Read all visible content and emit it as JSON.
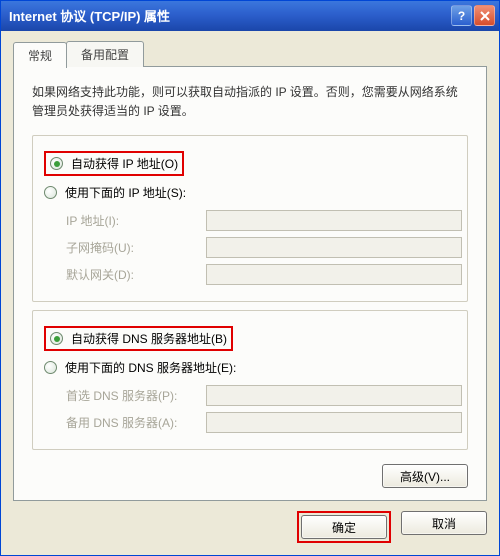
{
  "window": {
    "title": "Internet 协议 (TCP/IP) 属性"
  },
  "tabs": {
    "general": "常规",
    "alternate": "备用配置"
  },
  "description": "如果网络支持此功能，则可以获取自动指派的 IP 设置。否则，您需要从网络系统管理员处获得适当的 IP 设置。",
  "ip": {
    "auto": "自动获得 IP 地址(O)",
    "manual": "使用下面的 IP 地址(S):",
    "addr_label": "IP 地址(I):",
    "mask_label": "子网掩码(U):",
    "gateway_label": "默认网关(D):"
  },
  "dns": {
    "auto": "自动获得 DNS 服务器地址(B)",
    "manual": "使用下面的 DNS 服务器地址(E):",
    "preferred_label": "首选 DNS 服务器(P):",
    "alternate_label": "备用 DNS 服务器(A):"
  },
  "buttons": {
    "advanced": "高级(V)...",
    "ok": "确定",
    "cancel": "取消"
  }
}
